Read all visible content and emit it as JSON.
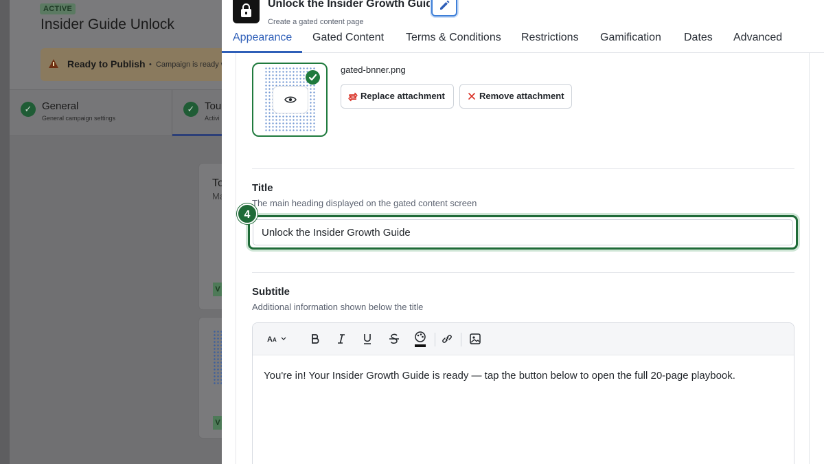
{
  "background": {
    "status_badge": "ACTIVE",
    "campaign_title": "Insider Guide Unlock",
    "banner": {
      "strong": "Ready to Publish",
      "separator": "•",
      "text": "Campaign is ready with"
    },
    "steps": [
      {
        "title": "General",
        "subtitle": "General campaign settings"
      },
      {
        "title": "Tou",
        "subtitle": "Activi"
      }
    ],
    "cards": [
      {
        "title": "To",
        "subtitle": "Ma",
        "badge": "V"
      },
      {
        "badge": "V"
      }
    ]
  },
  "panel": {
    "title": "Unlock the Insider Growth Guide",
    "subtitle": "Create a gated content page",
    "tabs": [
      {
        "label": "Appearance",
        "active": true
      },
      {
        "label": "Gated Content"
      },
      {
        "label": "Terms & Conditions"
      },
      {
        "label": "Restrictions"
      },
      {
        "label": "Gamification"
      },
      {
        "label": "Dates"
      },
      {
        "label": "Advanced"
      }
    ],
    "attachment": {
      "filename": "gated-bnner.png",
      "replace_label": "Replace attachment",
      "remove_label": "Remove attachment"
    },
    "title_field": {
      "label": "Title",
      "help": "The main heading displayed on the gated content screen",
      "value": "Unlock the Insider Growth Guide",
      "step_number": "4"
    },
    "subtitle_field": {
      "label": "Subtitle",
      "help": "Additional information shown below the title",
      "toolbar": [
        "font-size-icon",
        "bold-icon",
        "italic-icon",
        "underline-icon",
        "strikethrough-icon",
        "text-color-icon",
        "link-icon",
        "image-icon"
      ],
      "content": "You're in! Your Insider Growth Guide is ready — tap the button below to open the full 20-page playbook."
    }
  },
  "colors": {
    "accent_blue": "#2f5fb8",
    "success_green": "#1f7a3d",
    "focus_green": "#1f6b38",
    "danger_red": "#d93025"
  }
}
